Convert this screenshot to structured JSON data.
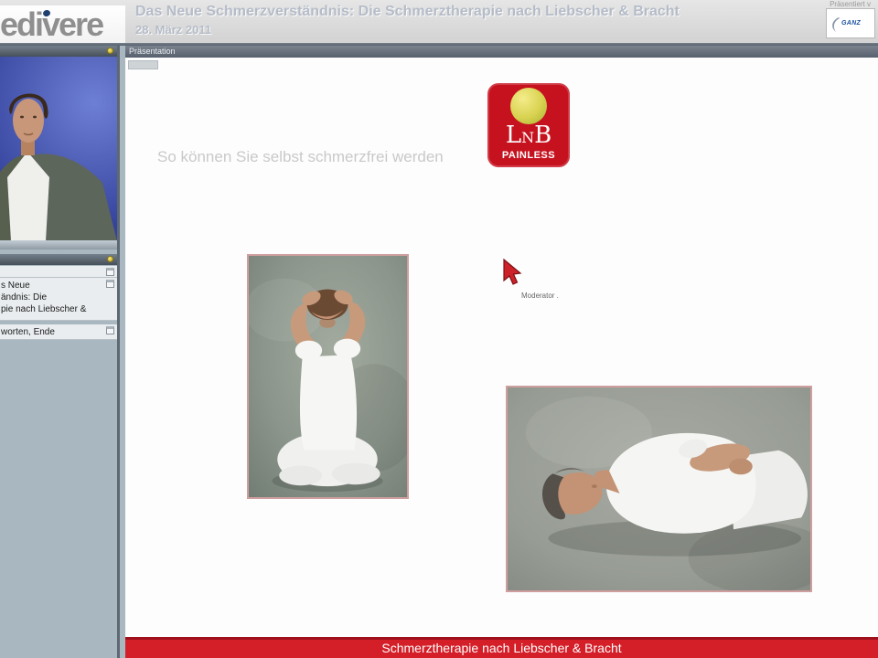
{
  "header": {
    "logo_text": "edivere",
    "title": "Das Neue Schmerzverständnis: Die Schmerztherapie nach Liebscher & Bracht",
    "date": "28. März 2011",
    "presented_by_label": "Präsentiert v",
    "partner_logo_text": "GANZ"
  },
  "sidebar": {
    "video_panel": {
      "control_icon": "yellow-dot-icon"
    },
    "agenda_panel": {
      "control_icon": "yellow-dot-icon",
      "items": [
        {
          "lines": [
            ""
          ],
          "icon": "note-icon"
        },
        {
          "lines": [
            "s Neue",
            "ändnis: Die",
            "pie nach Liebscher &"
          ],
          "icon": "note-icon"
        },
        {
          "lines": [
            "worten, Ende"
          ],
          "icon": "note-icon"
        }
      ]
    }
  },
  "main": {
    "tab_label": "Präsentation",
    "slide": {
      "title": "So können Sie selbst schmerzfrei werden",
      "lnb_logo": {
        "l": "L",
        "n": "N",
        "b": "B",
        "subtitle": "PAINLESS"
      },
      "moderator_label": "Moderator .",
      "photos": [
        {
          "name": "kneeling-person-photo"
        },
        {
          "name": "lying-person-photo"
        }
      ]
    },
    "footer_text": "Schmerztherapie nach Liebscher & Bracht"
  },
  "colors": {
    "footer_red": "#d41f29",
    "lnb_red": "#c6121f",
    "sidebar_gray_blue": "#a9b7c0",
    "video_blue": "#3a49a0",
    "header_title_gray": "#b5bcc8",
    "photo_border_pink": "#cf9f9f"
  }
}
